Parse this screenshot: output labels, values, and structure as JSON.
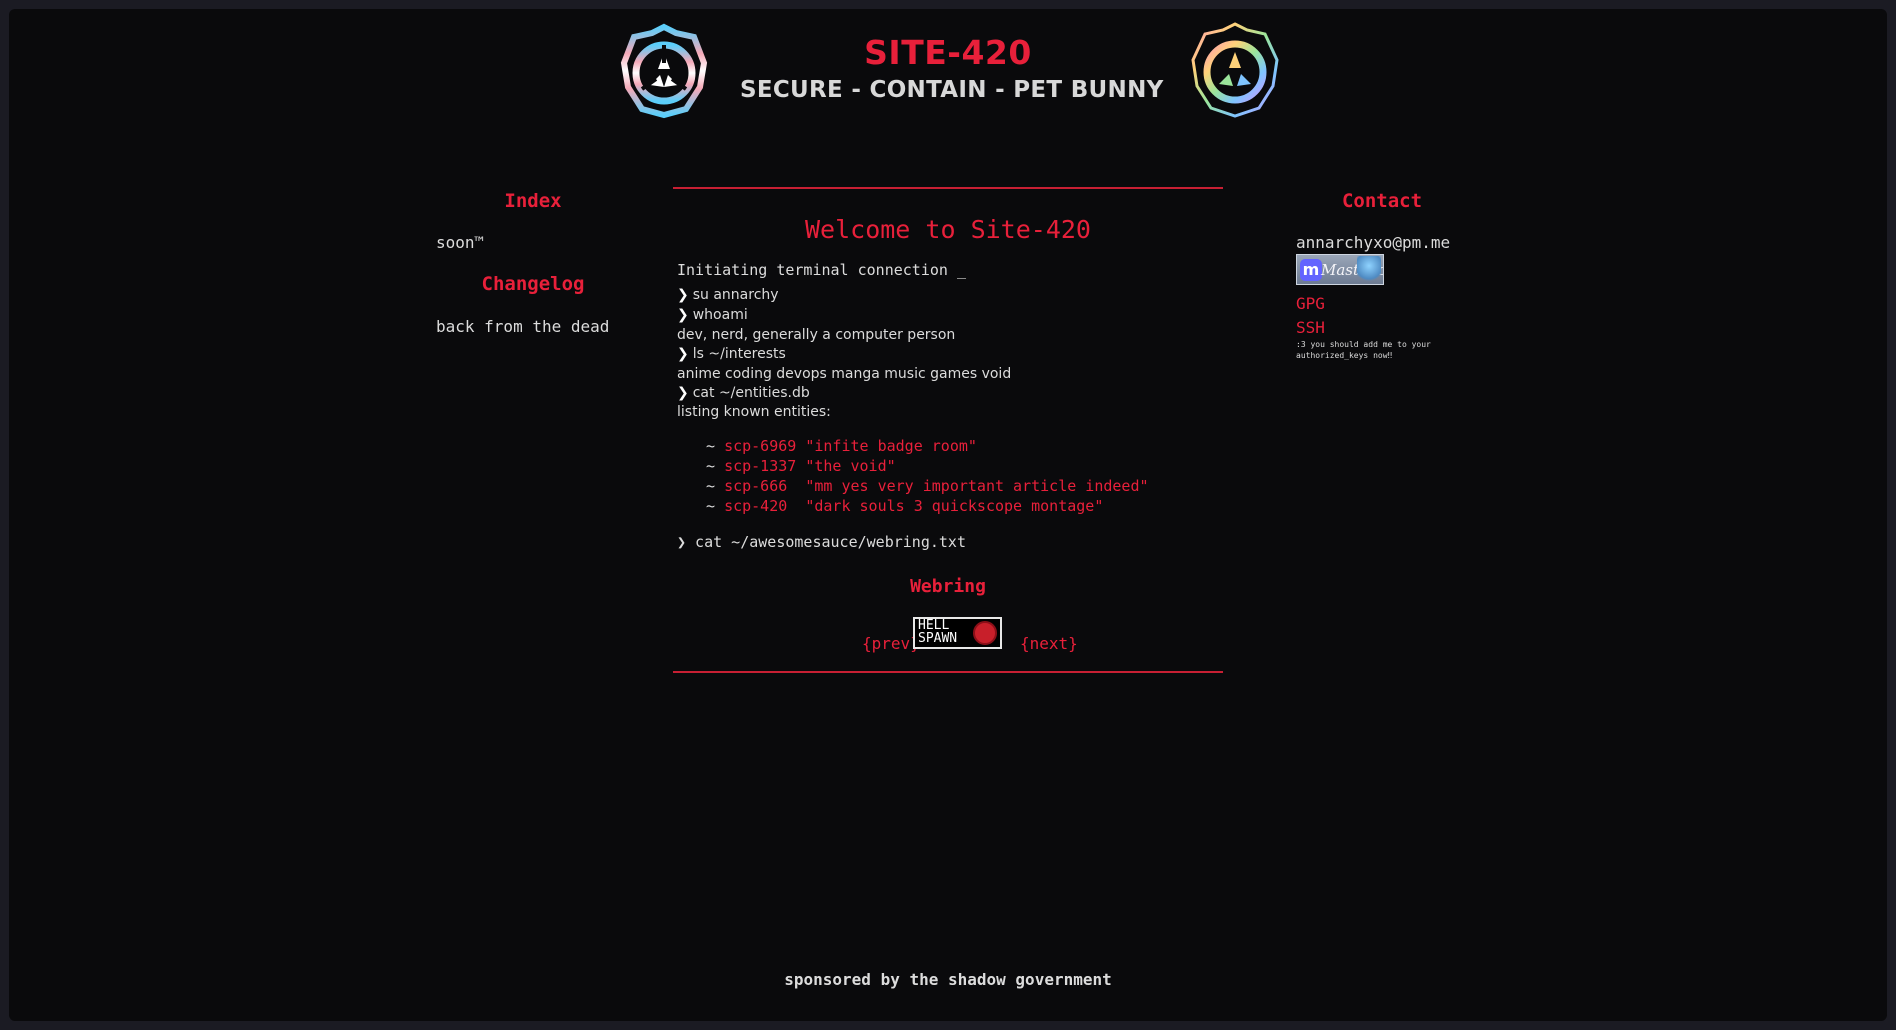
{
  "header": {
    "title": "SITE-420",
    "tagline": "SECURE - CONTAIN - PET BUNNY",
    "logo_left": "scp-logo-trans-flag",
    "logo_right": "scp-logo-rainbow"
  },
  "left": {
    "index_heading": "Index",
    "index_text": "soon™",
    "changelog_heading": "Changelog",
    "changelog_text": "back from the dead"
  },
  "main": {
    "welcome": "Welcome to Site-420",
    "initiating": "Initiating terminal connection _",
    "prompt_symbol": "❯",
    "terminal": [
      {
        "kind": "cmd",
        "text": "su annarchy"
      },
      {
        "kind": "cmd",
        "text": "whoami"
      },
      {
        "kind": "out",
        "text": "dev, nerd, generally a computer person"
      },
      {
        "kind": "cmd",
        "text": "ls ~/interests"
      },
      {
        "kind": "out",
        "text": "anime coding devops manga music games void"
      },
      {
        "kind": "cmd",
        "text": "cat ~/entities.db"
      },
      {
        "kind": "out",
        "text": "listing known entities:"
      }
    ],
    "entity_prefix": "~",
    "entities": [
      {
        "id": "scp-6969",
        "desc": "\"infite badge room\""
      },
      {
        "id": "scp-1337",
        "desc": "\"the void\""
      },
      {
        "id": "scp-666 ",
        "desc": "\"mm yes very important article indeed\""
      },
      {
        "id": "scp-420 ",
        "desc": "\"dark souls 3 quickscope montage\""
      }
    ],
    "webring_cmd": "❯ cat ~/awesomesauce/webring.txt",
    "webring_heading": "Webring",
    "webring_prev": "{prev}",
    "webring_next": "{next}",
    "webring_badge_text": "HELL\nSPAWN"
  },
  "right": {
    "contact_heading": "Contact",
    "email": "annarchyxo@pm.me",
    "mastodon_label": "Mastodon",
    "gpg": "GPG",
    "ssh": "SSH",
    "ssh_note": ":3 you should add me to your authorized_keys now‼"
  },
  "footer": {
    "text": "sponsored by the shadow government"
  }
}
